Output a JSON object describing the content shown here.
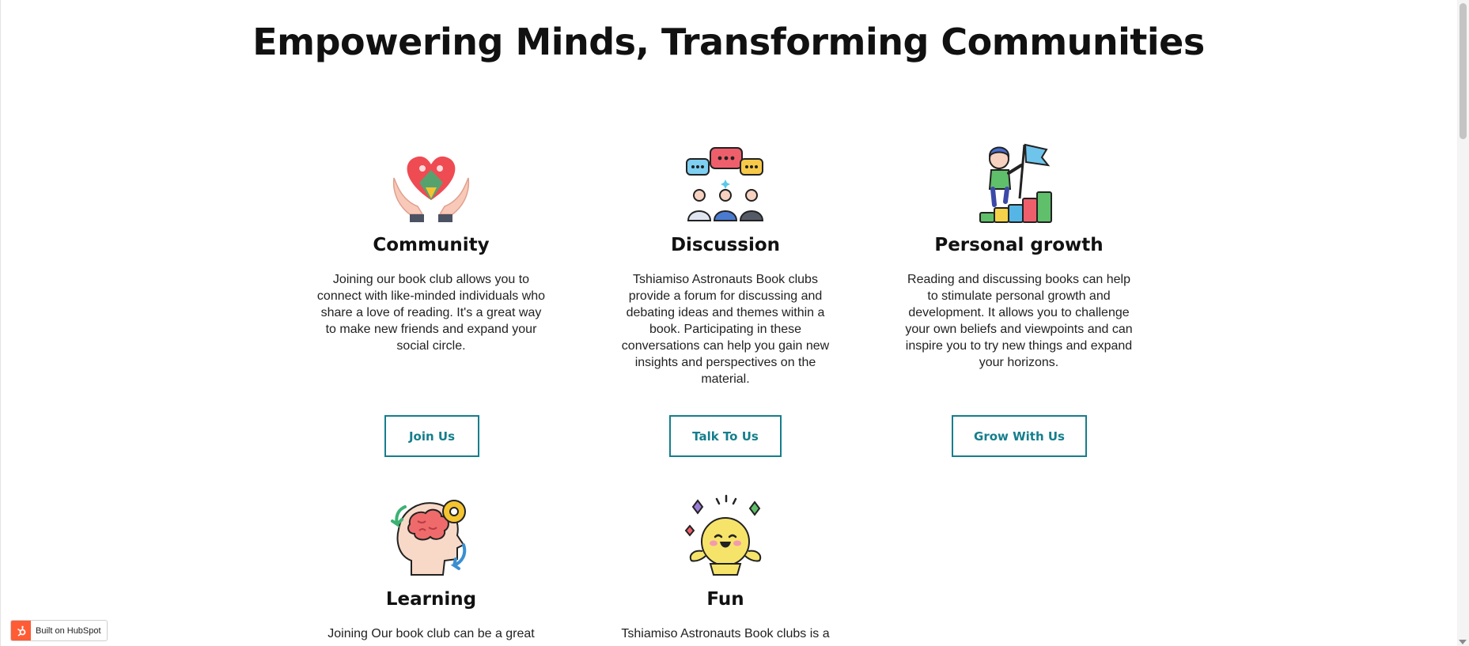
{
  "page": {
    "title": "Empowering Minds, Transforming Communities"
  },
  "cards": [
    {
      "heading": "Community",
      "icon": "heart-hands-icon",
      "text": "Joining our book club allows you to connect with like-minded individuals who share a love of reading. It's a great way to make new friends and expand your social circle.",
      "button": "Join Us"
    },
    {
      "heading": "Discussion",
      "icon": "chat-group-icon",
      "text": "Tshiamiso Astronauts Book clubs provide a forum for discussing and debating ideas and themes within a book. Participating in these conversations can help you gain new insights and perspectives on the material.",
      "button": "Talk To Us"
    },
    {
      "heading": "Personal growth",
      "icon": "growth-flag-icon",
      "text": "Reading and discussing books can help to stimulate personal growth and development. It allows you to challenge your own beliefs and viewpoints and can inspire you to try new things and expand your horizons.",
      "button": "Grow With Us"
    },
    {
      "heading": "Learning",
      "icon": "brain-gear-icon",
      "text": "Joining Our book club can be a great"
    },
    {
      "heading": "Fun",
      "icon": "happy-face-icon",
      "text": "Tshiamiso Astronauts Book clubs is a"
    }
  ],
  "badge": {
    "label": "Built on HubSpot",
    "icon": "hubspot-logo-icon"
  },
  "colors": {
    "accent": "#157e8c",
    "hubspot": "#ff5c35"
  }
}
